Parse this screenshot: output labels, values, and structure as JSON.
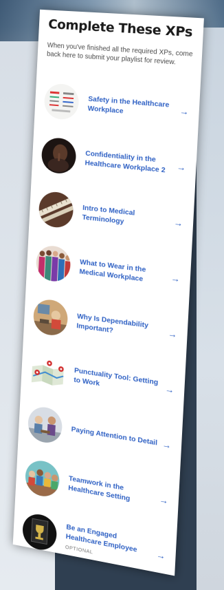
{
  "header": {
    "title": "Complete These XPs",
    "description": "When you've finished all the required XPs, come back here to submit your playlist for review."
  },
  "icons": {
    "arrow": "→"
  },
  "items": [
    {
      "title": "Safety in the Healthcare Workplace",
      "icon": "safety-infographic",
      "optional": ""
    },
    {
      "title": "Confidentiality in the Healthcare Workplace 2",
      "icon": "person-shush",
      "optional": ""
    },
    {
      "title": "Intro to Medical Terminology",
      "icon": "medical-ruler",
      "optional": ""
    },
    {
      "title": "What to Wear in the Medical Workplace",
      "icon": "medical-team",
      "optional": ""
    },
    {
      "title": "Why Is Dependability Important?",
      "icon": "cartoon-classroom",
      "optional": ""
    },
    {
      "title": "Punctuality Tool: Getting to Work",
      "icon": "map-pins",
      "optional": ""
    },
    {
      "title": "Paying Attention to Detail",
      "icon": "cartoon-workers",
      "optional": ""
    },
    {
      "title": "Teamwork in the Healthcare Setting",
      "icon": "cartoon-team",
      "optional": ""
    },
    {
      "title": "Be an Engaged Healthcare Employee",
      "icon": "trophy-poster",
      "optional": "OPTIONAL"
    }
  ]
}
